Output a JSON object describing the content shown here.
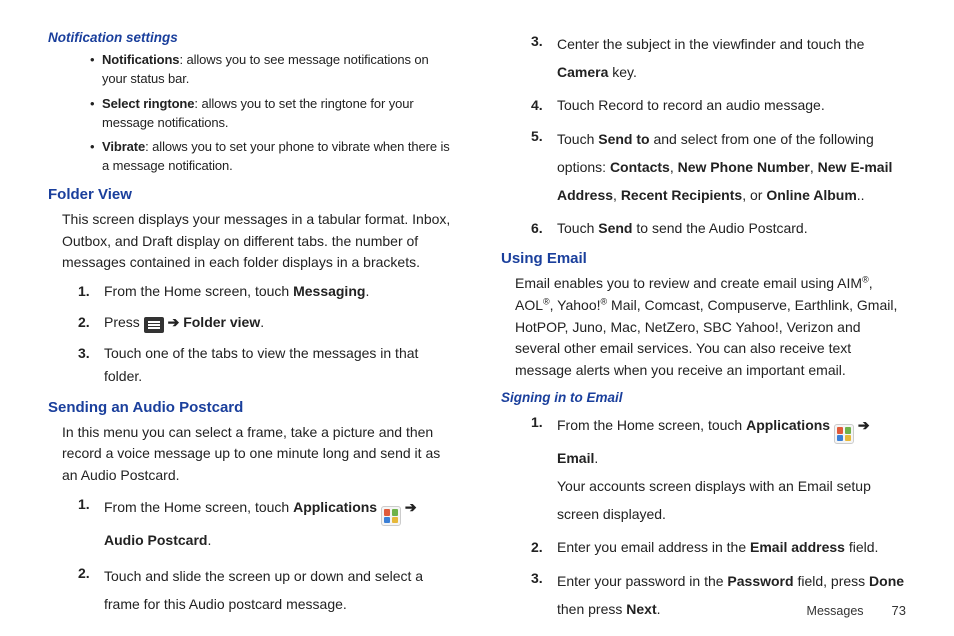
{
  "left": {
    "notif_hdr": "Notification settings",
    "bullets": [
      {
        "term": "Notifications",
        "rest": ": allows you to see message notifications on your status bar."
      },
      {
        "term": "Select ringtone",
        "rest": ": allows you to set the ringtone for your message notifications."
      },
      {
        "term": "Vibrate",
        "rest": ": allows you to set your phone to vibrate when there is a message notification."
      }
    ],
    "folder_hdr": "Folder View",
    "folder_body": "This screen displays your messages in a tabular format. Inbox, Outbox, and Draft display on different tabs. the number of messages contained in each folder displays in a brackets.",
    "folder_steps": {
      "s1_a": "From the Home screen, touch ",
      "s1_b": "Messaging",
      "s1_c": ".",
      "s2_a": "Press ",
      "s2_arrow": " ➔ ",
      "s2_b": "Folder view",
      "s2_c": ".",
      "s3": "Touch one of the tabs to view the messages in that folder."
    },
    "audio_hdr": "Sending an Audio Postcard",
    "audio_body": "In this menu you can select a frame, take a picture and then record a voice message up to one minute long and send it as an Audio Postcard.",
    "audio_steps": {
      "s1_a": "From the Home screen, touch ",
      "s1_b": "Applications",
      "s1_arrow": "  ➔ ",
      "s1_c": "Audio Postcard",
      "s1_d": ".",
      "s2": "Touch and slide the screen up or down and select a frame for this Audio postcard message."
    }
  },
  "right": {
    "cont_steps": {
      "s3_a": "Center the subject in the viewfinder and touch the ",
      "s3_b": "Camera",
      "s3_c": " key.",
      "s4": "Touch Record to record an audio message.",
      "s5_a": "Touch ",
      "s5_b": "Send to",
      "s5_c": " and select from one of the following options: ",
      "s5_opts": [
        "Contacts",
        "New Phone Number",
        "New E-mail Address",
        "Recent Recipients",
        "Online Album"
      ],
      "s5_end": "..",
      "s6_a": "Touch ",
      "s6_b": "Send",
      "s6_c": " to send the Audio Postcard."
    },
    "email_hdr": "Using Email",
    "email_body_a": "Email enables you to review and create email using AIM",
    "email_body_b": ", AOL",
    "email_body_c": ", Yahoo!",
    "email_body_d": " Mail, Comcast, Compuserve, Earthlink, Gmail, HotPOP, Juno, Mac, NetZero, SBC Yahoo!, Verizon and several other email services. You can also receive text message alerts when you receive an important email.",
    "reg": "®",
    "signin_hdr": "Signing in to Email",
    "signin_steps": {
      "s1_a": "From the Home screen, touch ",
      "s1_b": "Applications",
      "s1_arrow": "  ➔ ",
      "s1_c": "Email",
      "s1_d": ".",
      "s1_line2": "Your accounts screen displays with an Email setup screen displayed.",
      "s2_a": "Enter you email address in the ",
      "s2_b": "Email address",
      "s2_c": " field.",
      "s3_a": "Enter your password in the ",
      "s3_b": "Password",
      "s3_c": " field, press ",
      "s3_d": "Done",
      "s3_e": " then press ",
      "s3_f": "Next",
      "s3_g": "."
    }
  },
  "footer": {
    "section": "Messages",
    "page": "73"
  },
  "sep": ", ",
  "or": ", or "
}
